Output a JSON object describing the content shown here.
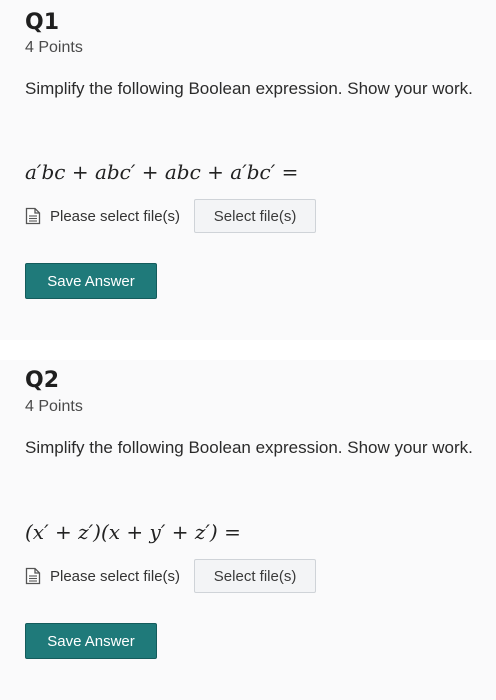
{
  "questions": [
    {
      "title": "Q1",
      "points": "4 Points",
      "prompt": "Simplify the following Boolean expression.  Show your work.",
      "expression": "a′bc + abc′ + abc + a′bc′ =",
      "file_label": "Please select file(s)",
      "select_label": "Select file(s)",
      "save_label": "Save Answer"
    },
    {
      "title": "Q2",
      "points": "4 Points",
      "prompt": "Simplify the following Boolean expression.  Show your work.",
      "expression": "(x′ + z′)(x + y′ + z′) =",
      "file_label": "Please select file(s)",
      "select_label": "Select file(s)",
      "save_label": "Save Answer"
    }
  ],
  "icons": {
    "file": "document-icon"
  },
  "colors": {
    "save_button": "#1f7a7a",
    "select_button_bg": "#f3f4f6",
    "panel_bg": "#fafafb"
  }
}
